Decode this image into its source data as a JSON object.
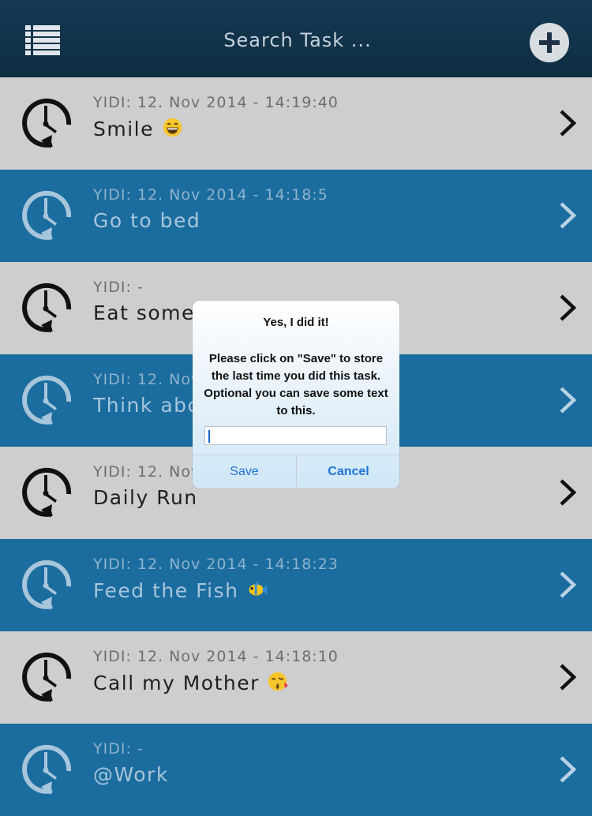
{
  "header": {
    "search_placeholder": "Search Task ...",
    "menu_icon": "list-icon",
    "add_icon": "plus-icon"
  },
  "colors": {
    "header_bg": "#122f44",
    "row_light": "#cecece",
    "row_dark": "#1b6c9f",
    "dialog_button": "#1e74d6"
  },
  "tasks": [
    {
      "meta": "YIDI: 12. Nov 2014 - 14:19:40",
      "title": "Smile",
      "emoji": "grinning-face-emoji"
    },
    {
      "meta": "YIDI: 12. Nov 2014 - 14:18:5",
      "title": "Go to bed"
    },
    {
      "meta": "YIDI: -",
      "title": "Eat someth"
    },
    {
      "meta": "YIDI: 12. Nov 2",
      "title": "Think about"
    },
    {
      "meta": "YIDI: 12. Nov 2",
      "title": "Daily Run"
    },
    {
      "meta": "YIDI: 12. Nov 2014 - 14:18:23",
      "title": "Feed the Fish",
      "emoji": "tropical-fish-emoji"
    },
    {
      "meta": "YIDI: 12. Nov 2014 - 14:18:10",
      "title": "Call my Mother",
      "emoji": "kissing-face-emoji"
    },
    {
      "meta": "YIDI: -",
      "title": "@Work"
    }
  ],
  "dialog": {
    "title": "Yes, I did it!",
    "message": "Please click on \"Save\" to store the last time you did this task. Optional you can save some text to this.",
    "input_value": "",
    "save_label": "Save",
    "cancel_label": "Cancel"
  }
}
